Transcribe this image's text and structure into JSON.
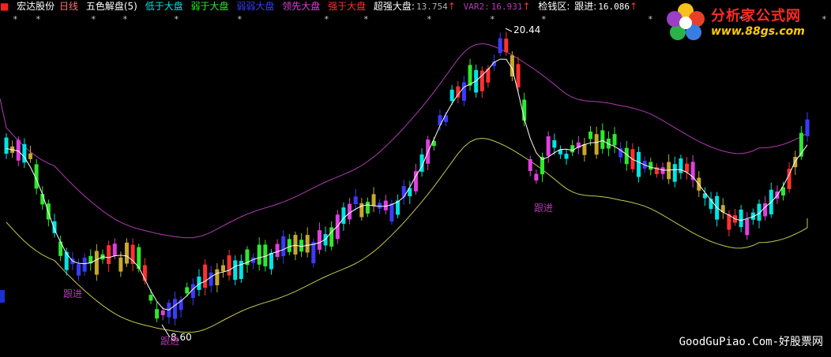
{
  "header": {
    "stock_name": "宏达股份",
    "period": "日线",
    "indicator": "五色解盘(5)",
    "items": [
      {
        "label": "低于大盘",
        "color": "#00e5e5"
      },
      {
        "label": "弱于大盘",
        "color": "#2ee82e"
      },
      {
        "label": "弱弱大盘",
        "color": "#3b3bff"
      },
      {
        "label": "领先大盘",
        "color": "#e040e0"
      },
      {
        "label": "强于大盘",
        "color": "#ff3030"
      }
    ],
    "super_label": "超强大盘:",
    "super_value": "13.754",
    "var2_label": "VAR2:",
    "var2_value": "16.931",
    "money_label": "检钱区:",
    "follow_label": "跟进:",
    "follow_value": "16.086",
    "arrow": "↑"
  },
  "logo": {
    "text": "分析家公式网",
    "url": "www.88gs.com"
  },
  "watermark": "GoodGuPiao.Com-好股票网",
  "chart_data": {
    "type": "candlestick",
    "price_range": [
      8.3,
      21.6
    ],
    "candles_count": 134,
    "annotations": [
      {
        "text": "20.44",
        "kind": "high"
      },
      {
        "text": "8.60",
        "kind": "low"
      },
      {
        "text": "跟进"
      },
      {
        "text": "跟进"
      },
      {
        "text": "跟进"
      }
    ],
    "signal_marks": "*",
    "colors": {
      "white_line": "#ffffff",
      "upper_band": "#b23bb2",
      "lower_band": "#c8c850",
      "candle_palette": [
        "#00e5e5",
        "#2ee82e",
        "#3b3bff",
        "#e040e0",
        "#ff3030",
        "#c8a82e",
        "#ffffff"
      ]
    }
  }
}
